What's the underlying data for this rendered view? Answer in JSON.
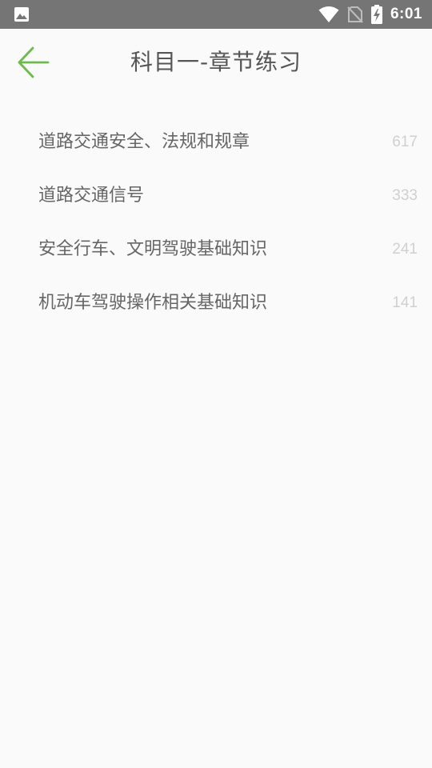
{
  "status_bar": {
    "time": "6:01",
    "icons": [
      "image-icon",
      "wifi-icon",
      "no-sim-icon",
      "battery-charging-icon"
    ]
  },
  "header": {
    "title": "科目一-章节练习",
    "back_icon": "arrow-left-icon",
    "accent_color": "#6dbb4a"
  },
  "chapters": [
    {
      "name": "道路交通安全、法规和规章",
      "count": "617"
    },
    {
      "name": "道路交通信号",
      "count": "333"
    },
    {
      "name": "安全行车、文明驾驶基础知识",
      "count": "241"
    },
    {
      "name": "机动车驾驶操作相关基础知识",
      "count": "141"
    }
  ]
}
